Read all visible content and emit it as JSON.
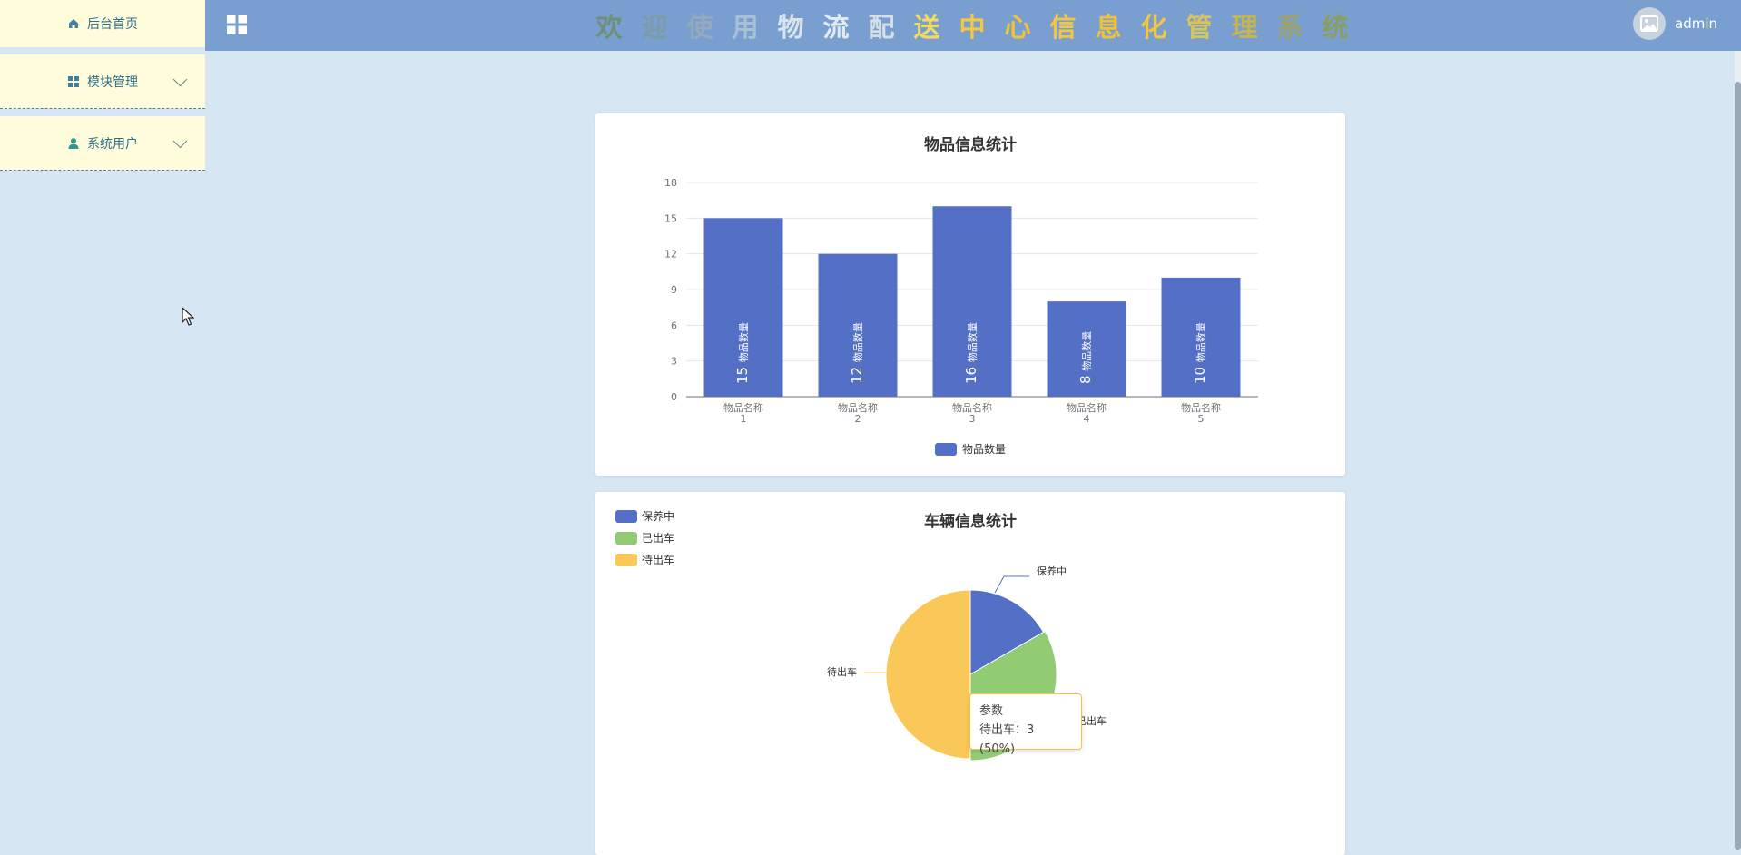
{
  "sidebar": {
    "items": [
      {
        "label": "后台首页",
        "icon": "home-icon"
      },
      {
        "label": "模块管理",
        "icon": "grid-icon"
      },
      {
        "label": "系统用户",
        "icon": "user-icon"
      }
    ]
  },
  "header": {
    "title": "欢迎使用物流配送中心信息化管理系统",
    "title_chars": [
      "欢",
      "迎",
      "使",
      "用",
      "物",
      "流",
      "配",
      "送",
      "中",
      "心",
      "信",
      "息",
      "化",
      "管",
      "理",
      "系",
      "统"
    ],
    "title_colors": [
      "#6f8f7a",
      "#7c9aa7",
      "#95a9bd",
      "#a9bfd4",
      "#d9e3ec",
      "#e3ebf2",
      "#d6dfe8",
      "#f0dc62",
      "#f5c842",
      "#f2c33a",
      "#f4c63f",
      "#f0c23a",
      "#f1c640",
      "#d6c45c",
      "#c6b352",
      "#9ea26a",
      "#8a9e63"
    ],
    "user_name": "admin"
  },
  "bar_card": {
    "title": "物品信息统计",
    "bar_label_prefix": "物品数量"
  },
  "pie_card": {
    "title": "车辆信息统计"
  },
  "tooltip": {
    "title": "参数",
    "text": "待出车：3 (50%)"
  },
  "colors": {
    "accent_blue": "#5470c6",
    "green": "#91cc75",
    "yellow": "#fac858",
    "header": "#799fd0",
    "sidebar": "#fffcdb"
  },
  "chart_data": [
    {
      "type": "bar",
      "title": "物品信息统计",
      "categories": [
        "物品名称1",
        "物品名称2",
        "物品名称3",
        "物品名称4",
        "物品名称5"
      ],
      "series": [
        {
          "name": "物品数量",
          "values": [
            15,
            12,
            16,
            8,
            10
          ]
        }
      ],
      "ylim": [
        0,
        18
      ],
      "yticks": [
        0,
        3,
        6,
        9,
        12,
        15,
        18
      ],
      "grid": true,
      "legend": "bottom-center"
    },
    {
      "type": "pie",
      "title": "车辆信息统计",
      "labels": [
        "保养中",
        "已出车",
        "待出车"
      ],
      "values": [
        1,
        2,
        3
      ],
      "legend": "top-left"
    }
  ]
}
